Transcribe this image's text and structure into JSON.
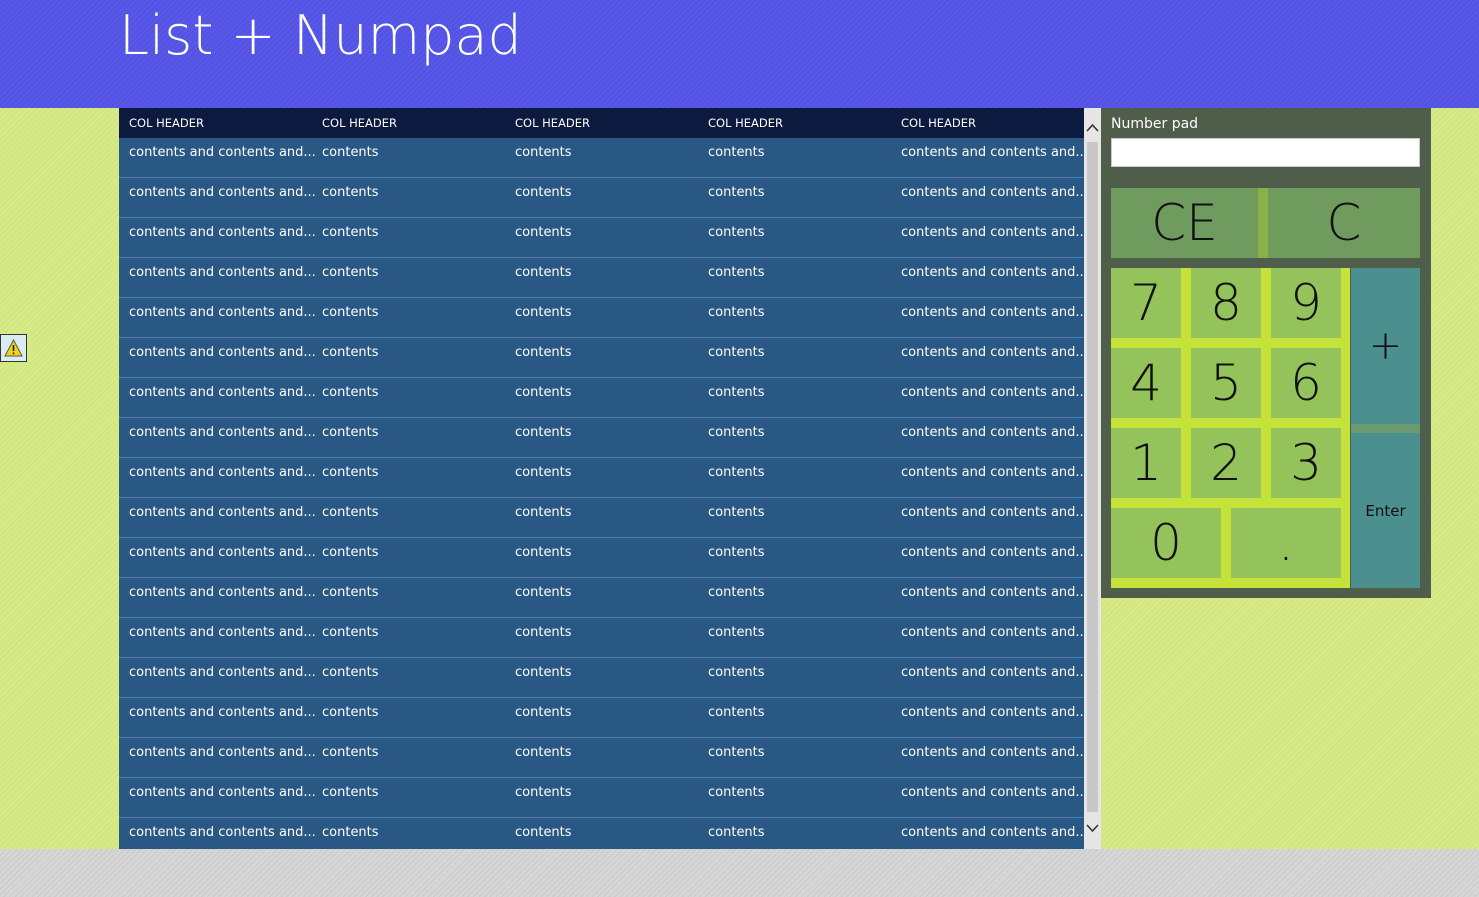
{
  "app": {
    "title": "List + Numpad"
  },
  "grid": {
    "columns": [
      "COL HEADER",
      "COL HEADER",
      "COL HEADER",
      "COL HEADER",
      "COL HEADER"
    ],
    "rows": [
      [
        "contents and contents and...",
        "contents",
        "contents",
        "contents",
        "contents and contents and..."
      ],
      [
        "contents and contents and...",
        "contents",
        "contents",
        "contents",
        "contents and contents and..."
      ],
      [
        "contents and contents and...",
        "contents",
        "contents",
        "contents",
        "contents and contents and..."
      ],
      [
        "contents and contents and...",
        "contents",
        "contents",
        "contents",
        "contents and contents and..."
      ],
      [
        "contents and contents and...",
        "contents",
        "contents",
        "contents",
        "contents and contents and..."
      ],
      [
        "contents and contents and...",
        "contents",
        "contents",
        "contents",
        "contents and contents and..."
      ],
      [
        "contents and contents and...",
        "contents",
        "contents",
        "contents",
        "contents and contents and..."
      ],
      [
        "contents and contents and...",
        "contents",
        "contents",
        "contents",
        "contents and contents and..."
      ],
      [
        "contents and contents and...",
        "contents",
        "contents",
        "contents",
        "contents and contents and..."
      ],
      [
        "contents and contents and...",
        "contents",
        "contents",
        "contents",
        "contents and contents and..."
      ],
      [
        "contents and contents and...",
        "contents",
        "contents",
        "contents",
        "contents and contents and..."
      ],
      [
        "contents and contents and...",
        "contents",
        "contents",
        "contents",
        "contents and contents and..."
      ],
      [
        "contents and contents and...",
        "contents",
        "contents",
        "contents",
        "contents and contents and..."
      ],
      [
        "contents and contents and...",
        "contents",
        "contents",
        "contents",
        "contents and contents and..."
      ],
      [
        "contents and contents and...",
        "contents",
        "contents",
        "contents",
        "contents and contents and..."
      ],
      [
        "contents and contents and...",
        "contents",
        "contents",
        "contents",
        "contents and contents and..."
      ],
      [
        "contents and contents and...",
        "contents",
        "contents",
        "contents",
        "contents and contents and..."
      ],
      [
        "contents and contents and...",
        "contents",
        "contents",
        "contents",
        "contents and contents and..."
      ]
    ]
  },
  "numpad": {
    "label": "Number pad",
    "input_value": "",
    "keys": {
      "ce": "CE",
      "c": "C",
      "k7": "7",
      "k8": "8",
      "k9": "9",
      "k4": "4",
      "k5": "5",
      "k6": "6",
      "k1": "1",
      "k2": "2",
      "k3": "3",
      "k0": "0",
      "dot": ".",
      "plus": "+",
      "enter": "Enter"
    }
  },
  "icons": {
    "warning": "warning-icon",
    "scroll_up": "chevron-up-icon",
    "scroll_down": "chevron-down-icon"
  },
  "colors": {
    "header_bg": "#5353e6",
    "content_bg": "#d3e77f",
    "grid_header_bg": "#0c1a40",
    "grid_row_bg": "#2a5885",
    "numpad_bg": "#4e5e4a",
    "digit_key": "#94c35c",
    "clear_key": "#6f9b5e",
    "op_key": "#4b8f8e"
  }
}
